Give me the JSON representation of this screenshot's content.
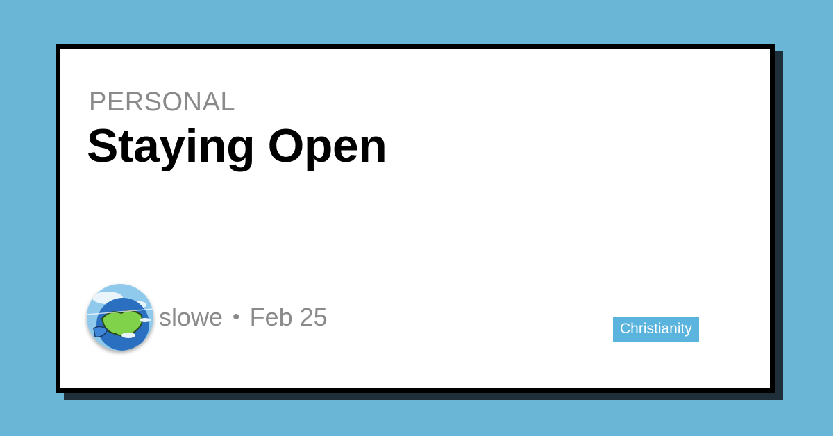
{
  "post": {
    "category": "PERSONAL",
    "title": "Staying Open",
    "author": "slowe",
    "separator": "•",
    "date": "Feb 25",
    "tag": "Christianity"
  },
  "colors": {
    "background": "#69b6d6",
    "card": "#ffffff",
    "border": "#000000",
    "muted_text": "#8a8a8a",
    "tag_bg": "#5ab4dd"
  }
}
